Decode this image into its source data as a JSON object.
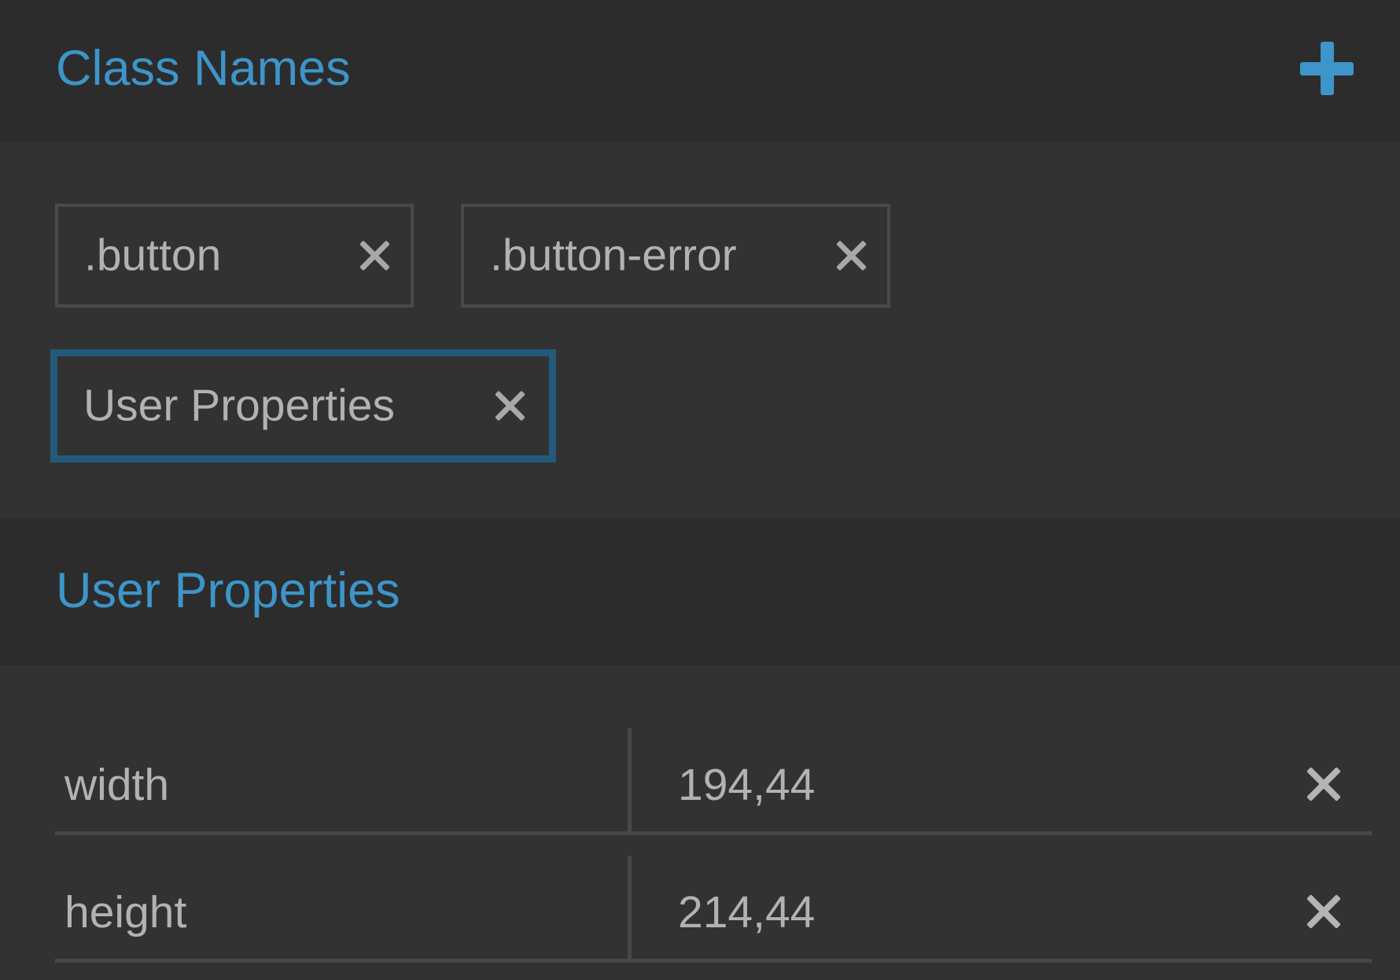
{
  "class_names": {
    "title": "Class Names",
    "add_icon": "plus-icon",
    "accent_color": "#3d95c9",
    "tags": [
      {
        "label": ".button",
        "remove_icon": "close-icon",
        "active": false
      },
      {
        "label": ".button-error",
        "remove_icon": "close-icon",
        "active": false
      },
      {
        "label": "User Properties",
        "remove_icon": "close-icon",
        "active": true
      }
    ]
  },
  "user_properties": {
    "title": "User Properties",
    "rows": [
      {
        "key": "width",
        "value": "194,44",
        "remove_icon": "close-icon"
      },
      {
        "key": "height",
        "value": "214,44",
        "remove_icon": "close-icon"
      }
    ]
  }
}
